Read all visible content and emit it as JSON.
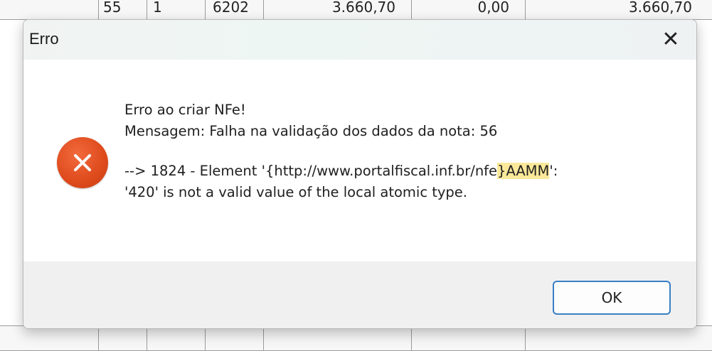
{
  "background_table": {
    "top_row": [
      "55",
      "1",
      "6202",
      "3.660,70",
      "0,00",
      "3.660,70"
    ],
    "bottom_row": [
      "",
      "",
      "",
      "",
      "",
      ""
    ]
  },
  "dialog": {
    "title": "Erro",
    "close_label": "✕",
    "icon": "error-x-icon",
    "message": {
      "line1": "Erro ao criar NFe!",
      "line2": "Mensagem: Falha na validação dos dados da nota: 56",
      "line3_prefix": " --> 1824 - Element '{http://www.portalfiscal.inf.br/nfe",
      "line3_highlight": "}AAMM",
      "line3_suffix": "':",
      "line4": "'420' is not a valid value of the local atomic type."
    },
    "ok_label": "OK"
  },
  "colors": {
    "error_icon": "#de4a1c",
    "highlight": "#fbe99a",
    "ok_border": "#3a7fc4"
  }
}
